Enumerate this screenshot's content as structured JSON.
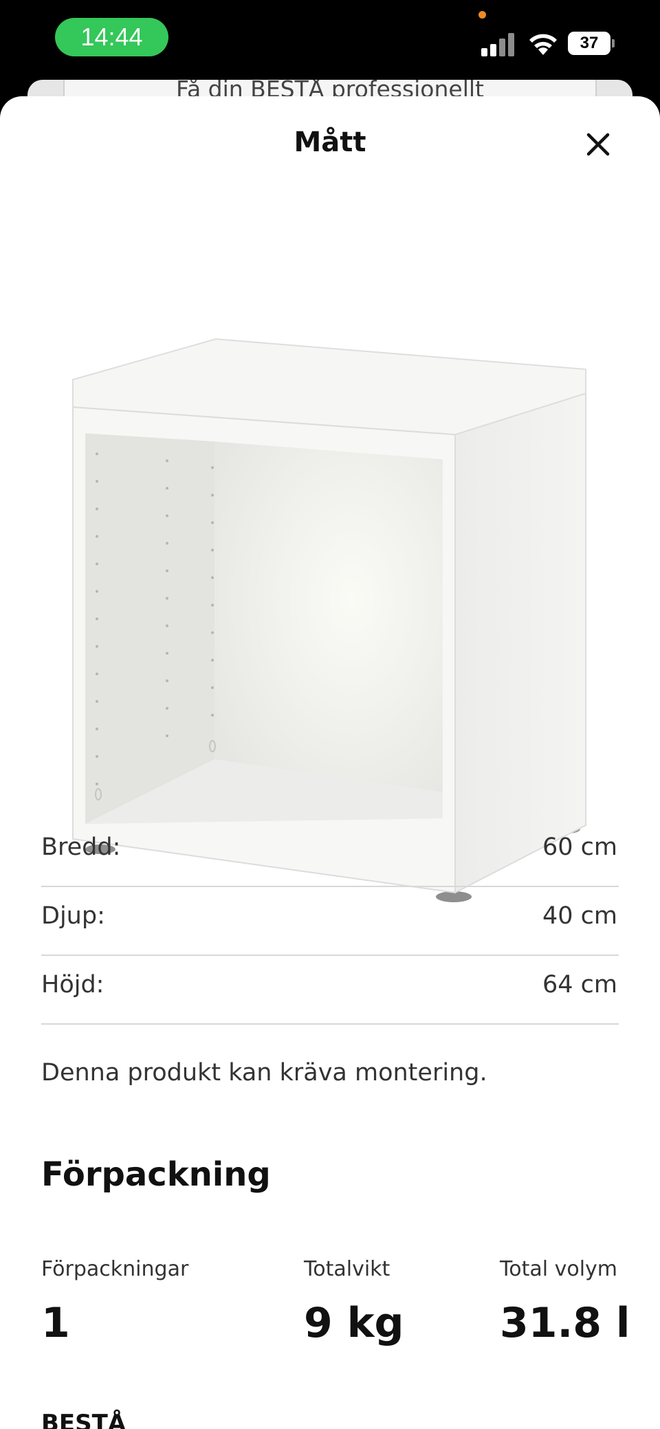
{
  "status_bar": {
    "time": "14:44",
    "battery": "37",
    "icons": [
      "signal-icon",
      "wifi-icon",
      "battery-icon"
    ]
  },
  "background_card": {
    "text": "Få din BESTÅ professionellt"
  },
  "sheet": {
    "title": "Mått",
    "close_icon": "close-icon"
  },
  "dimensions": [
    {
      "label": "Bredd:",
      "value": "60 cm"
    },
    {
      "label": "Djup:",
      "value": "40 cm"
    },
    {
      "label": "Höjd:",
      "value": "64 cm"
    }
  ],
  "assembly_note": "Denna produkt kan kräva montering.",
  "packaging": {
    "title": "Förpackning",
    "count_label": "Förpackningar",
    "count_value": "1",
    "weight_label": "Totalvikt",
    "weight_value": "9 kg",
    "volume_label": "Total volym",
    "volume_value": "31.8 l"
  },
  "next_section": "BESTÅ",
  "colors": {
    "status_pill": "#34c759",
    "divider": "#d8d8d8"
  }
}
